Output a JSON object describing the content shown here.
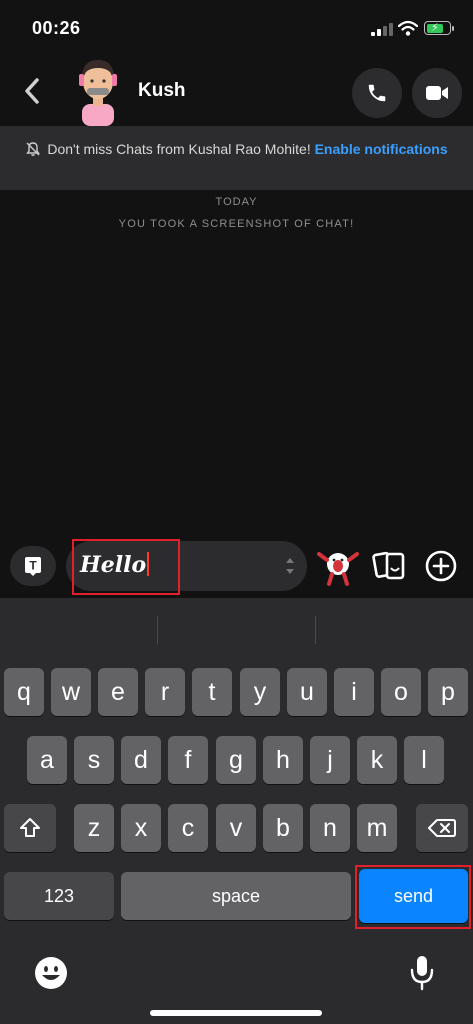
{
  "status_bar": {
    "time": "00:26"
  },
  "header": {
    "contact_name": "Kush"
  },
  "banner": {
    "text": "Don't miss Chats from Kushal Rao Mohite!",
    "link": "Enable notifications"
  },
  "chat": {
    "date_label": "TODAY",
    "system_message": "YOU TOOK A SCREENSHOT OF CHAT!"
  },
  "composer": {
    "value": "Hello"
  },
  "keyboard": {
    "row1": [
      "q",
      "w",
      "e",
      "r",
      "t",
      "y",
      "u",
      "i",
      "o",
      "p"
    ],
    "row2": [
      "a",
      "s",
      "d",
      "f",
      "g",
      "h",
      "j",
      "k",
      "l"
    ],
    "row3": [
      "z",
      "x",
      "c",
      "v",
      "b",
      "n",
      "m"
    ],
    "numbers_label": "123",
    "space_label": "space",
    "send_label": "send"
  },
  "colors": {
    "accent": "#0a84ff",
    "link": "#3aa0ff",
    "highlight": "#e0202a"
  },
  "icons": [
    "back-icon",
    "phone-icon",
    "video-icon",
    "bell-off-icon",
    "text-icon",
    "sticker-icon",
    "plus-icon",
    "shift-icon",
    "delete-icon",
    "emoji-icon",
    "mic-icon"
  ]
}
